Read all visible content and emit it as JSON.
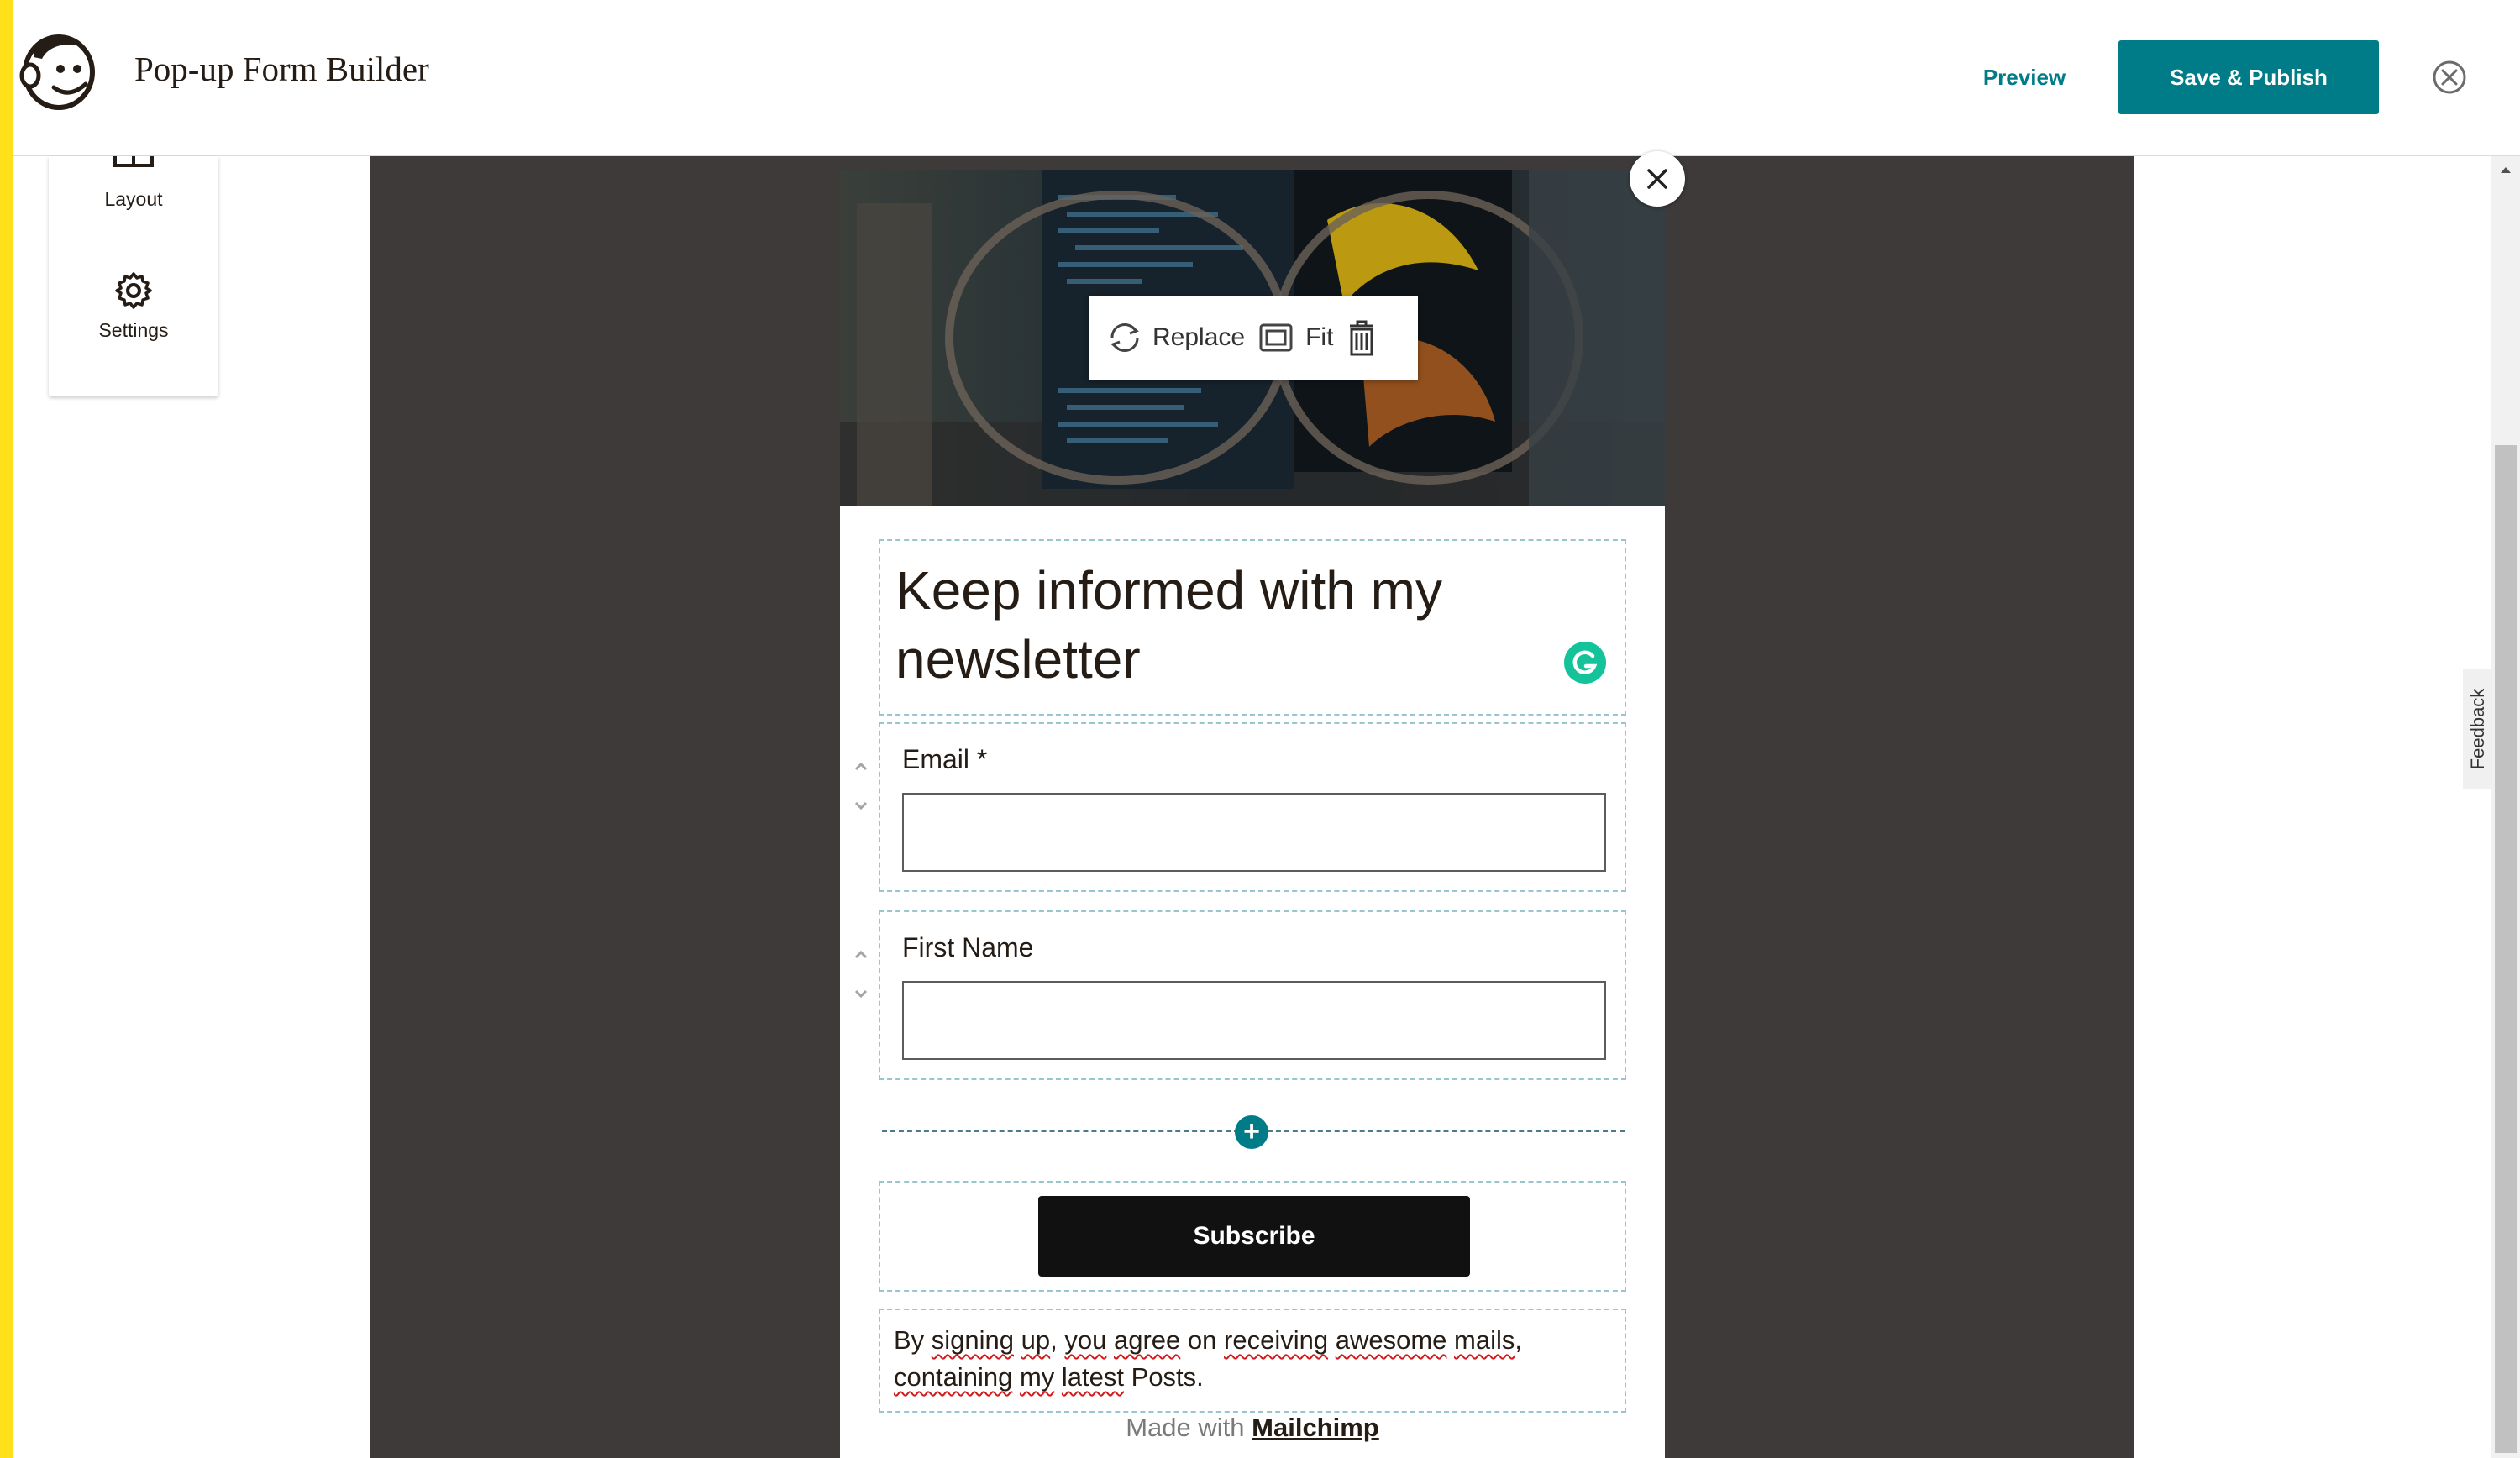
{
  "header": {
    "app_title": "Pop-up Form Builder",
    "preview_label": "Preview",
    "publish_label": "Save & Publish",
    "logo_icon": "mailchimp-freddie-logo",
    "close_icon": "close-circle-icon"
  },
  "sidebar": {
    "items": [
      {
        "label": "Layout",
        "icon": "layout-icon"
      },
      {
        "label": "Settings",
        "icon": "gear-icon"
      }
    ]
  },
  "image_toolbar": {
    "replace_label": "Replace",
    "fit_label": "Fit",
    "delete_icon": "trash-icon"
  },
  "form": {
    "headline": "Keep informed with my newsletter",
    "email_label": "Email *",
    "email_value": "",
    "first_name_label": "First Name",
    "first_name_value": "",
    "subscribe_label": "Subscribe",
    "made_with_text": "Made with",
    "made_with_link": "Mailchimp"
  },
  "feedback_label": "Feedback",
  "colors": {
    "brand_teal": "#007c89",
    "brand_yellow": "#ffe01b",
    "canvas_bg": "#3d3a39",
    "grammarly_green": "#15c39a"
  }
}
